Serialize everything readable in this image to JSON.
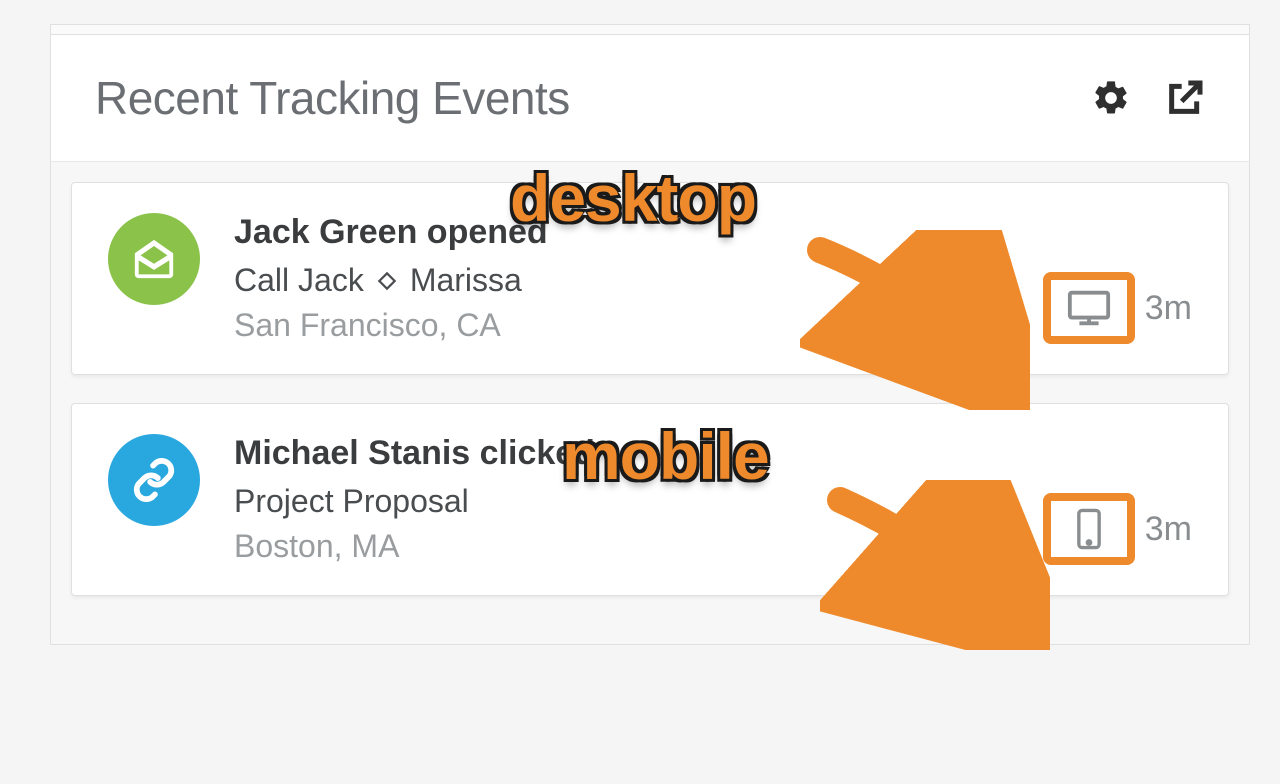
{
  "panel": {
    "title": "Recent Tracking Events"
  },
  "events": [
    {
      "icon": "email-open",
      "avatar_color": "green",
      "title": "Jack Green opened",
      "subject_prefix": "Call Jack",
      "subject_suffix": "Marissa",
      "location": "San Francisco, CA",
      "device": "desktop",
      "time": "3m"
    },
    {
      "icon": "link",
      "avatar_color": "blue",
      "title": "Michael Stanis clicked",
      "subject_prefix": "Project Proposal",
      "subject_suffix": "",
      "location": "Boston, MA",
      "device": "mobile",
      "time": "3m"
    }
  ],
  "annotations": {
    "desktop_label": "desktop",
    "mobile_label": "mobile"
  },
  "colors": {
    "accent_orange": "#ee8a2c",
    "avatar_green": "#8bc34a",
    "avatar_blue": "#29a7df"
  }
}
